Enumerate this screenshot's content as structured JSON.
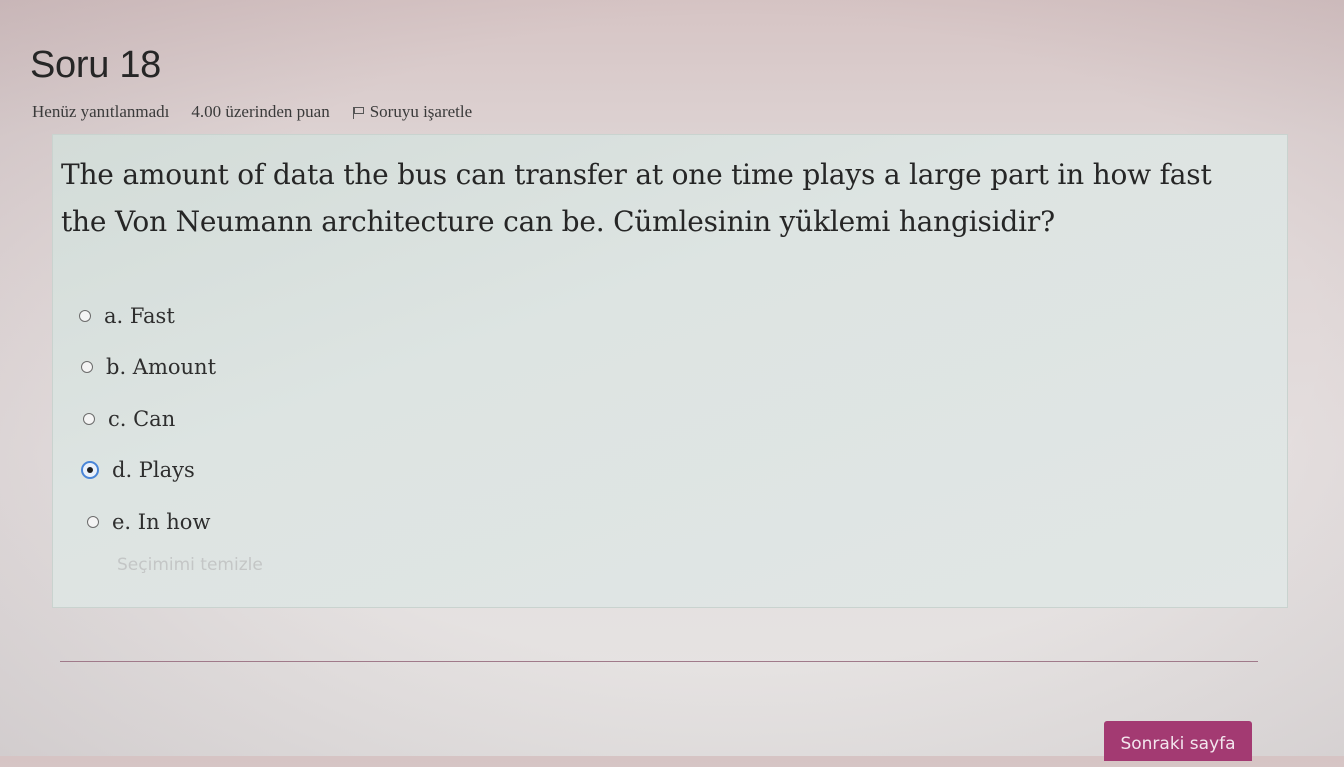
{
  "question": {
    "title": "Soru 18",
    "status": "Henüz yanıtlanmadı",
    "points": "4.00 üzerinden puan",
    "flag_label": "Soruyu işaretle",
    "text": "The amount of data the bus can transfer at one time plays a large part in how fast the Von Neumann architecture can be. Cümlesinin yüklemi hangisidir?",
    "answers": [
      {
        "label": "a. Fast",
        "selected": false
      },
      {
        "label": "b. Amount",
        "selected": false
      },
      {
        "label": "c. Can",
        "selected": false
      },
      {
        "label": "d. Plays",
        "selected": true
      },
      {
        "label": "e. In how",
        "selected": false
      }
    ],
    "clear_choice_label": "Seçimimi temizle"
  },
  "navigation": {
    "next_page_label": "Sonraki sayfa"
  },
  "colors": {
    "accent_button": "#a33a72",
    "radio_selected_border": "#4a86d8",
    "question_box_bg": "#dde4e2"
  },
  "icons": {
    "flag": "flag-icon"
  }
}
